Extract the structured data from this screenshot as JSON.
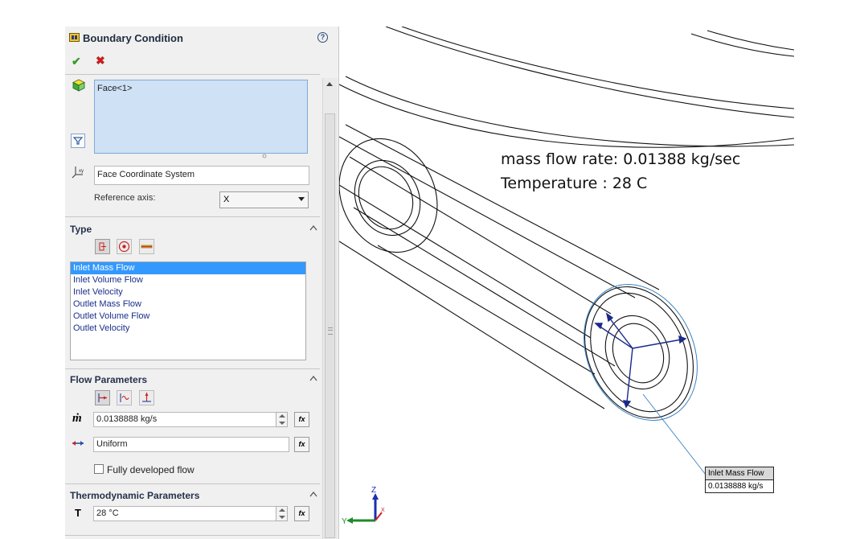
{
  "panel": {
    "title": "Boundary Condition",
    "help_icon": "?",
    "ok_icon": "✔",
    "cancel_icon": "✖",
    "selection": {
      "face": "Face<1>"
    },
    "coordinate_system": "Face Coordinate System",
    "reference_axis": {
      "label": "Reference axis:",
      "value": "X"
    },
    "type": {
      "title": "Type",
      "options": [
        "Inlet Mass Flow",
        "Inlet Volume Flow",
        "Inlet Velocity",
        "Outlet Mass Flow",
        "Outlet Volume Flow",
        "Outlet Velocity"
      ],
      "selected": "Inlet Mass Flow"
    },
    "flow": {
      "title": "Flow Parameters",
      "mass_symbol": "ṁ",
      "mass_value": "0.0138888 kg/s",
      "profile": "Uniform",
      "fully_developed_label": "Fully developed flow",
      "fully_developed_checked": false,
      "fx": "fx"
    },
    "thermo": {
      "title": "Thermodynamic Parameters",
      "temp_symbol": "T",
      "temp_value": "28 °C"
    }
  },
  "annotations": {
    "mass_flow": "mass flow rate: 0.01388 kg/sec",
    "temperature": "Temperature : 28 C"
  },
  "callout": {
    "title": "Inlet Mass Flow",
    "value": "0.0138888 kg/s"
  },
  "triad": {
    "x": "X",
    "y": "Y",
    "z": "Z"
  },
  "colors": {
    "selection_fill": "#cfe1f5",
    "list_selected": "#3399ff",
    "callout_leader": "#3b82c4"
  }
}
